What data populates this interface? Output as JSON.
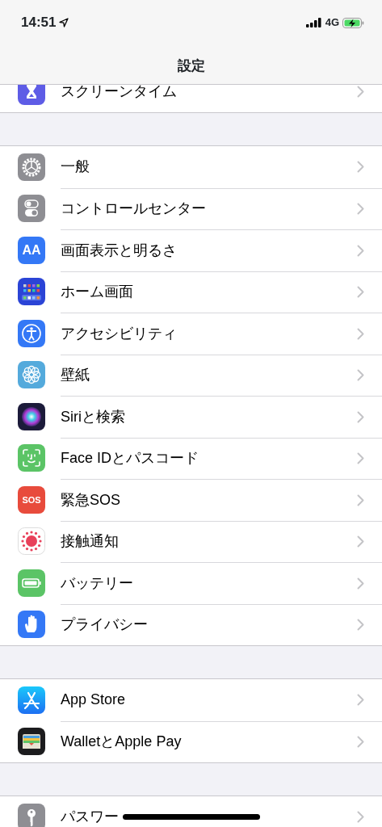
{
  "status_bar": {
    "time": "14:51",
    "network": "4G"
  },
  "nav": {
    "title": "設定"
  },
  "sections": [
    {
      "rows": [
        {
          "label": "スクリーンタイム"
        }
      ]
    },
    {
      "rows": [
        {
          "label": "一般"
        },
        {
          "label": "コントロールセンター"
        },
        {
          "label": "画面表示と明るさ",
          "icon_text": "AA"
        },
        {
          "label": "ホーム画面"
        },
        {
          "label": "アクセシビリティ"
        },
        {
          "label": "壁紙"
        },
        {
          "label": "Siriと検索"
        },
        {
          "label": "Face IDとパスコード"
        },
        {
          "label": "緊急SOS",
          "icon_text": "SOS"
        },
        {
          "label": "接触通知"
        },
        {
          "label": "バッテリー"
        },
        {
          "label": "プライバシー"
        }
      ]
    },
    {
      "rows": [
        {
          "label": "App Store"
        },
        {
          "label": "WalletとApple Pay"
        }
      ]
    },
    {
      "rows": [
        {
          "label": "パスワー"
        }
      ]
    }
  ]
}
